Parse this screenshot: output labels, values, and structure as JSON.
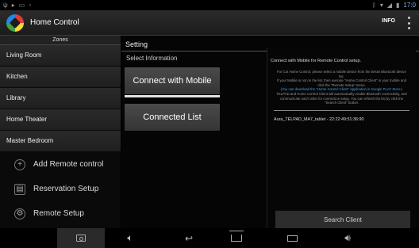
{
  "app": {
    "title": "Home Control",
    "info_label": "INFO"
  },
  "statusbar": {
    "time": "17:0"
  },
  "zones": {
    "header": "Zones",
    "items": [
      "Living Room",
      "Kitchen",
      "Library",
      "Home Theater",
      "Master Bedroom"
    ]
  },
  "menu": {
    "add_remote": "Add Remote control",
    "reservation": "Reservation Setup",
    "remote_setup": "Remote Setup"
  },
  "setting": {
    "header": "Setting",
    "select_info": "Select Information",
    "connect_mobile": "Connect with Mobile",
    "connected_list": "Connected List"
  },
  "panel": {
    "title": "Connect with Mobile for Remote Control setup.",
    "desc_1": "For Cut Home Control, please select a mobile device from the below Bluetooth device list.",
    "desc_2": "If your Mobile is not on the list, then execute \"Home Control Client\" in your mobile and click the \"Remote Setup\" menu.",
    "desc_hl": "(You can download the \"Home Control Client\" application in Google PLAY Store.)",
    "desc_3": "TELPAD and Home Control Client will automatically enable Bluetooth connectivity, and communicate each other for connection setup. You can refresh the list by click the \"Search Client\" button.",
    "device": "Aura_TELPAD_MA7_tablet - 22:22:49:51:36:90",
    "search_button": "Search Client"
  },
  "colors": {
    "accent_text": "#4aa3e0",
    "button_bg": "#3f3f3f"
  }
}
